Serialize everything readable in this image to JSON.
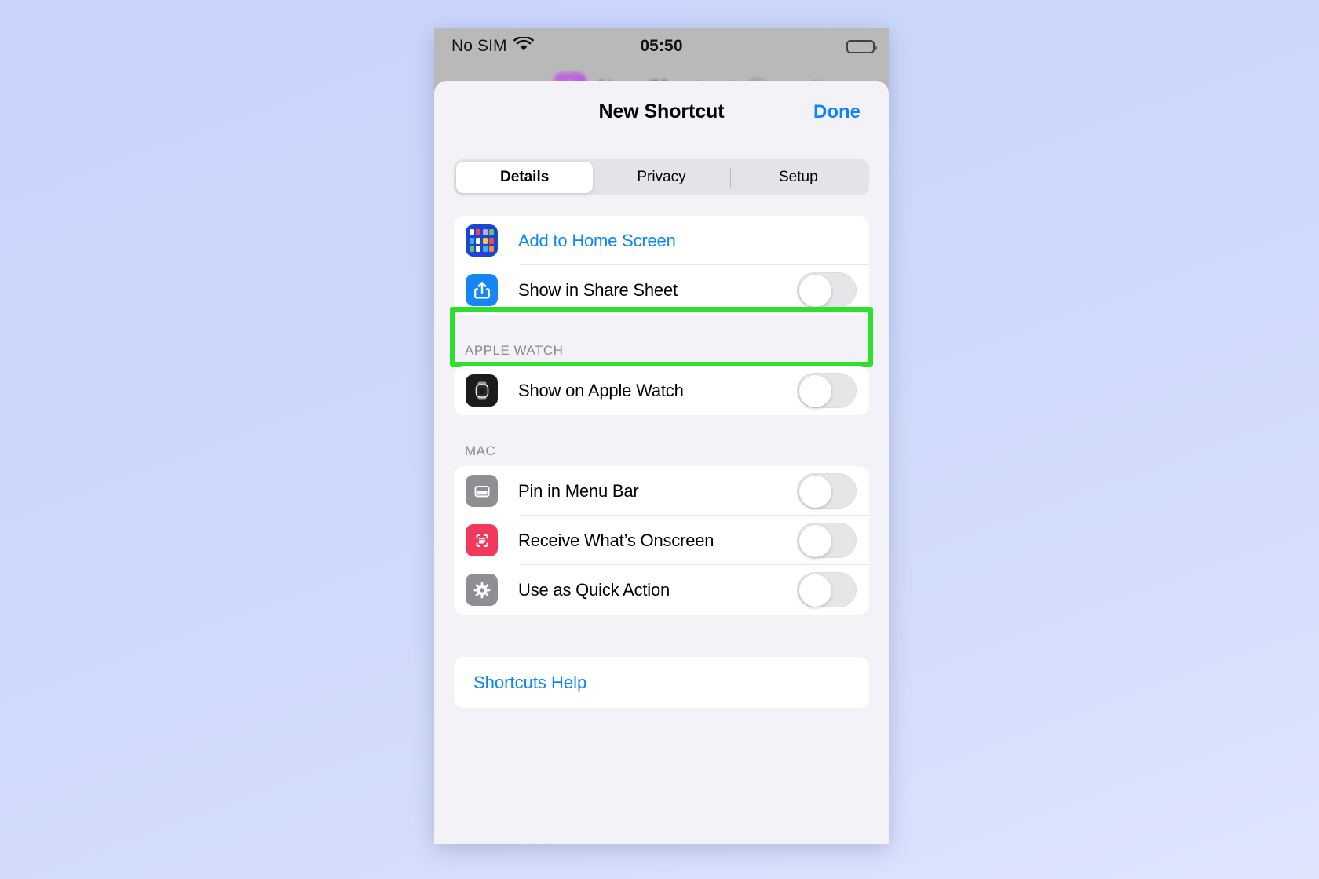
{
  "statusbar": {
    "carrier": "No SIM",
    "wifi_icon": "wifi-icon",
    "time": "05:50",
    "battery_icon": "battery-icon"
  },
  "background_nav": {
    "app_icon": "shortcuts-app-icon",
    "title": "New Shortcut",
    "done_label": "Done"
  },
  "sheet": {
    "title": "New Shortcut",
    "done_label": "Done",
    "tabs": [
      {
        "label": "Details",
        "active": true
      },
      {
        "label": "Privacy",
        "active": false
      },
      {
        "label": "Setup",
        "active": false
      }
    ],
    "groups": [
      {
        "section_label": "",
        "rows": [
          {
            "label": "Add to Home Screen",
            "icon": "home-screen-grid-icon",
            "style": "link",
            "control": "none"
          },
          {
            "label": "Show in Share Sheet",
            "icon": "share-sheet-icon",
            "style": "normal",
            "control": "toggle",
            "toggle_on": false,
            "highlighted": true
          }
        ]
      },
      {
        "section_label": "APPLE WATCH",
        "rows": [
          {
            "label": "Show on Apple Watch",
            "icon": "apple-watch-icon",
            "style": "normal",
            "control": "toggle",
            "toggle_on": false
          }
        ]
      },
      {
        "section_label": "MAC",
        "rows": [
          {
            "label": "Pin in Menu Bar",
            "icon": "menu-bar-window-icon",
            "style": "normal",
            "control": "toggle",
            "toggle_on": false
          },
          {
            "label": "Receive What’s Onscreen",
            "icon": "onscreen-scan-icon",
            "style": "normal",
            "control": "toggle",
            "toggle_on": false
          },
          {
            "label": "Use as Quick Action",
            "icon": "gear-icon",
            "style": "normal",
            "control": "toggle",
            "toggle_on": false
          }
        ]
      }
    ],
    "help_link": "Shortcuts Help"
  },
  "colors": {
    "accent_blue": "#0a84ff",
    "highlight_green": "#2ee02e",
    "sheet_bg": "#f2f2f7",
    "row_bg": "#ffffff",
    "home_icon_blue": "#1b46d2",
    "share_icon_blue": "#1785f5",
    "onscreen_red": "#f1395b",
    "gray_icon": "#8e8e93"
  }
}
